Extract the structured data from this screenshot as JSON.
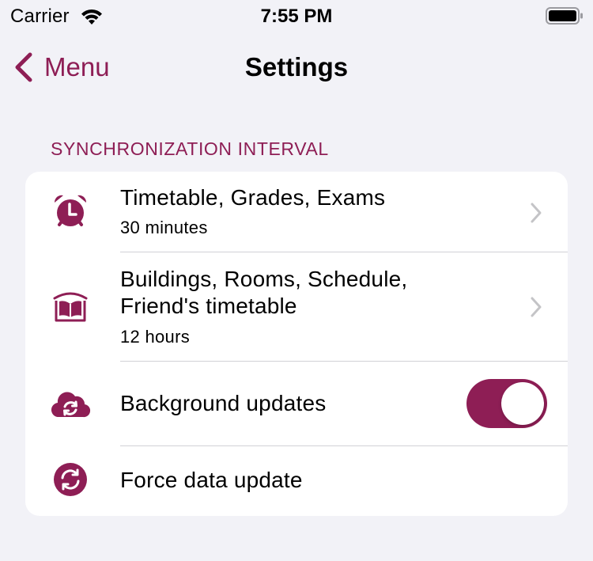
{
  "status_bar": {
    "carrier": "Carrier",
    "time": "7:55 PM"
  },
  "nav": {
    "back_label": "Menu",
    "title": "Settings"
  },
  "accent_color": "#8e1e55",
  "section": {
    "header": "SYNCHRONIZATION INTERVAL"
  },
  "rows": [
    {
      "icon": "alarm-clock-icon",
      "title": "Timetable, Grades, Exams",
      "subtitle": "30 minutes",
      "accessory": "chevron"
    },
    {
      "icon": "open-book-icon",
      "title_line1": "Buildings, Rooms, Schedule,",
      "title_line2": "Friend's timetable",
      "subtitle": "12 hours",
      "accessory": "chevron"
    },
    {
      "icon": "cloud-sync-icon",
      "title": "Background updates",
      "accessory": "toggle",
      "toggle_on": true
    },
    {
      "icon": "sync-circle-icon",
      "title": "Force data update",
      "accessory": "none"
    }
  ]
}
